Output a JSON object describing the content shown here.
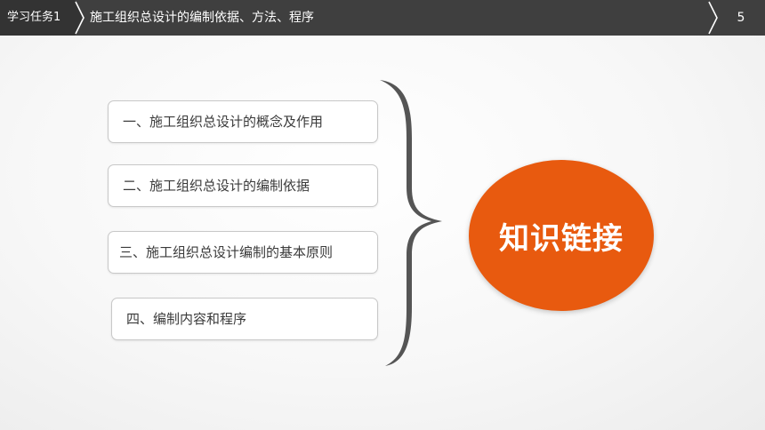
{
  "header": {
    "task_label": "学习任务1",
    "title": "施工组织总设计的编制依据、方法、程序",
    "page_number": "5"
  },
  "items": [
    {
      "label": "一、施工组织总设计的概念及作用"
    },
    {
      "label": "二、施工组织总设计的编制依据"
    },
    {
      "label": "三、施工组织总设计编制的基本原则"
    },
    {
      "label": "四、编制内容和程序"
    }
  ],
  "highlight": {
    "label": "知识链接"
  },
  "colors": {
    "header_bg": "#3f3f3f",
    "tag_bg": "#333333",
    "accent_orange": "#e85a0f",
    "brace": "#555555"
  }
}
